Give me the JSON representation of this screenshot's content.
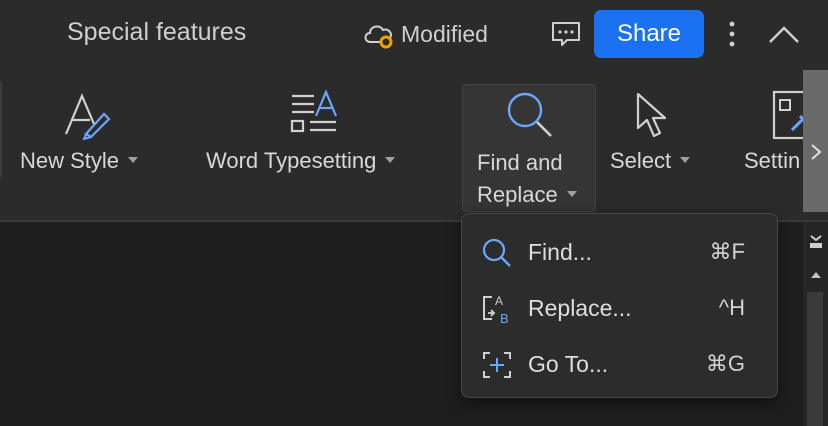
{
  "header": {
    "title": "Special features",
    "status": "Modified",
    "share_label": "Share"
  },
  "ribbon": {
    "tools": [
      {
        "label": "New Style"
      },
      {
        "label": "Word Typesetting"
      },
      {
        "label_line1": "Find and",
        "label_line2": "Replace"
      },
      {
        "label": "Select"
      },
      {
        "label": "Settin"
      }
    ]
  },
  "menu": {
    "items": [
      {
        "label": "Find...",
        "shortcut": "⌘F",
        "icon": "search-icon"
      },
      {
        "label": "Replace...",
        "shortcut": "^H",
        "icon": "replace-icon"
      },
      {
        "label": "Go To...",
        "shortcut": "⌘G",
        "icon": "goto-icon"
      }
    ]
  },
  "colors": {
    "accent": "#1a72f2",
    "icon_blue": "#6aa6ff",
    "cloud_badge": "#f0a000"
  }
}
